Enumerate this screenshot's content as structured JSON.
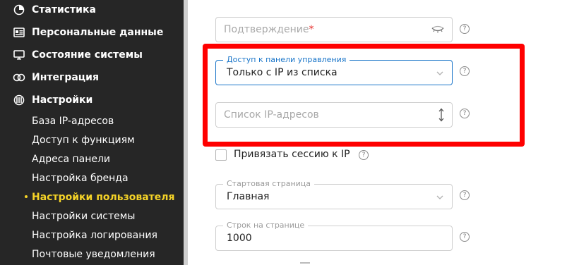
{
  "sidebar": {
    "items": [
      {
        "label": "Статистика",
        "icon": "statistics-icon"
      },
      {
        "label": "Персональные данные",
        "icon": "personal-data-icon"
      },
      {
        "label": "Состояние системы",
        "icon": "monitor-icon"
      },
      {
        "label": "Интеграция",
        "icon": "integration-icon"
      },
      {
        "label": "Настройки",
        "icon": "settings-icon"
      }
    ],
    "subitems": [
      {
        "label": "База IP-адресов"
      },
      {
        "label": "Доступ к функциям"
      },
      {
        "label": "Адреса панели"
      },
      {
        "label": "Настройка бренда"
      },
      {
        "label": "Настройки пользователя",
        "active": true
      },
      {
        "label": "Настройки системы"
      },
      {
        "label": "Настройка логирования"
      },
      {
        "label": "Почтовые уведомления"
      }
    ],
    "accent_color": "#f5d327"
  },
  "form": {
    "confirm": {
      "placeholder": "Подтверждение",
      "required_mark": "*"
    },
    "panel_access": {
      "label": "Доступ к панели управления",
      "value": "Только с IP из списка"
    },
    "ip_list": {
      "placeholder": "Список IP-адресов"
    },
    "bind_session": {
      "label": "Привязать сессию к IP",
      "checked": false
    },
    "start_page": {
      "label": "Стартовая страница",
      "value": "Главная"
    },
    "rows_per_page": {
      "label": "Строк на странице",
      "value": "1000"
    },
    "help_glyph": "?"
  },
  "colors": {
    "focus": "#1b76c9",
    "highlight": "#ff0000",
    "required": "#e6312f"
  }
}
